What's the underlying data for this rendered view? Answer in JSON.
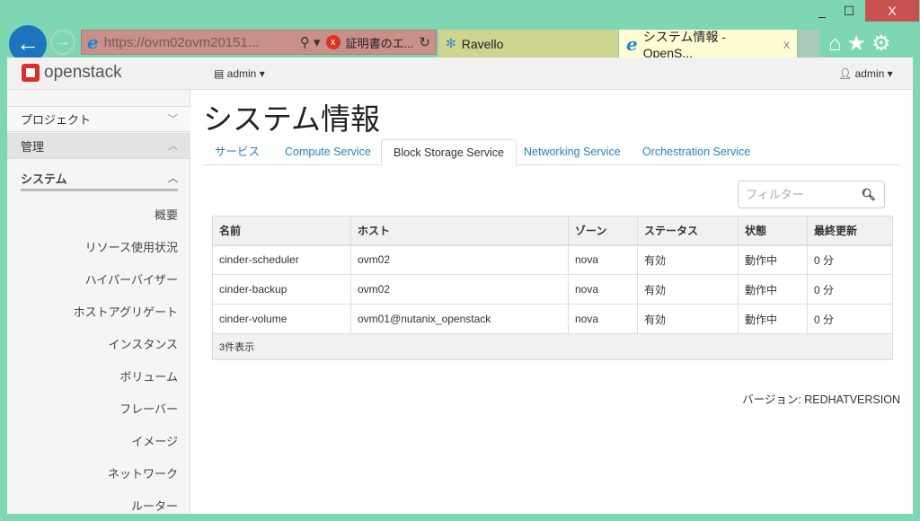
{
  "browser": {
    "url": "https://ovm02ovm20151...",
    "cert_error": "証明書のエ...",
    "tabs": [
      {
        "label": "Ravello"
      },
      {
        "label": "システム情報 - OpenS..."
      }
    ],
    "close_tab": "x"
  },
  "header": {
    "logo": "openstack",
    "project_menu": "admin",
    "user_menu": "admin"
  },
  "sidebar": {
    "sections": [
      {
        "label": "プロジェクト"
      },
      {
        "label": "管理"
      },
      {
        "label": "システム"
      }
    ],
    "items": [
      "概要",
      "リソース使用状況",
      "ハイパーバイザー",
      "ホストアグリゲート",
      "インスタンス",
      "ボリューム",
      "フレーバー",
      "イメージ",
      "ネットワーク",
      "ルーター"
    ]
  },
  "main": {
    "title": "システム情報",
    "tabs": [
      "サービス",
      "Compute Service",
      "Block Storage Service",
      "Networking Service",
      "Orchestration Service"
    ],
    "active_tab": "Block Storage Service",
    "filter_placeholder": "フィルター",
    "table": {
      "columns": [
        "名前",
        "ホスト",
        "ゾーン",
        "ステータス",
        "状態",
        "最終更新"
      ],
      "rows": [
        [
          "cinder-scheduler",
          "ovm02",
          "nova",
          "有効",
          "動作中",
          "0 分"
        ],
        [
          "cinder-backup",
          "ovm02",
          "nova",
          "有効",
          "動作中",
          "0 分"
        ],
        [
          "cinder-volume",
          "ovm01@nutanix_openstack",
          "nova",
          "有効",
          "動作中",
          "0 分"
        ]
      ],
      "footer": "3件表示"
    },
    "version": "バージョン: REDHATVERSION"
  },
  "colors": {
    "frame": "#7fd6b3",
    "link": "#2a7fc9",
    "brand": "#d9302b"
  }
}
